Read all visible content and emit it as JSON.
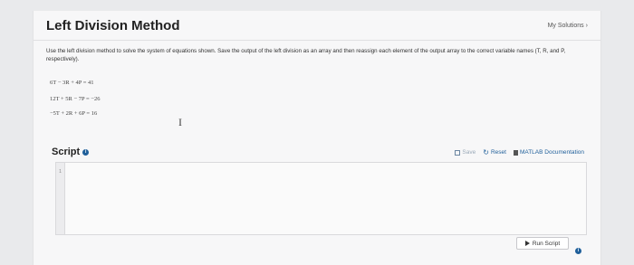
{
  "header": {
    "title": "Left Division Method",
    "my_solutions": "My Solutions",
    "chevron": "›"
  },
  "problem": {
    "description": "Use the left division method to solve the system of equations shown. Save the output of the left division as an array and then reassign each element of the output array to the correct variable names (T, R, and P, respectively).",
    "equations": [
      "6T − 3R + 4P = 41",
      "12T + 5R − 7P = −26",
      "−5T + 2R + 6P = 16"
    ]
  },
  "script": {
    "label": "Script",
    "info_icon": "i",
    "toolbar": {
      "save": "Save",
      "reset": "Reset",
      "docs": "MATLAB Documentation"
    },
    "line_numbers": [
      "1"
    ]
  },
  "run": {
    "label": "Run Script"
  },
  "colors": {
    "accent": "#1f5f9a",
    "background": "#e9eaec",
    "card": "#f7f7f8"
  },
  "icons": {
    "save": "save-icon",
    "reset": "reset-icon",
    "docs": "documentation-icon",
    "run": "play-icon",
    "info": "info-icon",
    "cursor": "text-cursor-icon"
  }
}
